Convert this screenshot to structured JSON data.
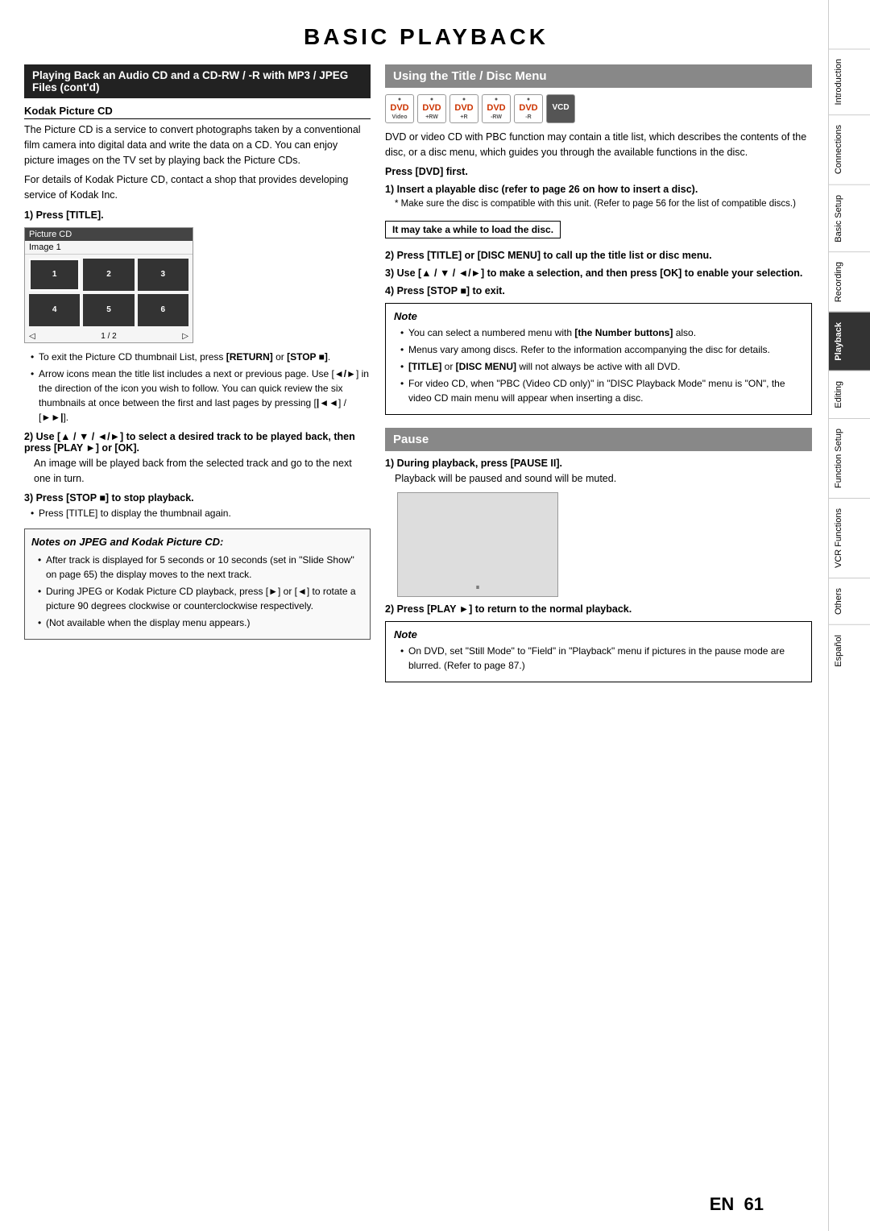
{
  "page": {
    "title": "BASIC PLAYBACK",
    "page_number": "EN 61"
  },
  "left_section": {
    "header": "Playing Back an Audio CD and a CD-RW / -R with MP3 / JPEG Files (cont'd)",
    "kodak": {
      "title": "Kodak Picture CD",
      "para1": "The Picture CD is a service to convert photographs taken by a conventional film camera into digital data and write the data on a CD. You can enjoy picture images on the TV set by playing back the Picture CDs.",
      "para2": "For details of Kodak Picture CD, contact a shop that provides developing service of Kodak Inc.",
      "step1_label": "1) Press [TITLE].",
      "picture_cd_label": "Picture CD",
      "image_label": "Image 1",
      "page_indicator": "1 / 2",
      "bullets1": [
        "To exit the Picture CD thumbnail List, press [RETURN] or [STOP ■].",
        "Arrow icons mean the title list includes a next or previous page. Use [◄/►] in the direction of the icon you wish to follow. You can quick review the six thumbnails at once between the first and last pages by pressing [|◄◄] / [►►|]."
      ],
      "step2_label": "2) Use [▲ / ▼ / ◄/►] to select a desired track to be played back, then press [PLAY ►] or [OK].",
      "step2_body": "An image will be played back from the selected track and go to the next one in turn.",
      "step3_label": "3) Press [STOP ■] to stop playback.",
      "step3_bullet": "Press [TITLE] to display the thumbnail again."
    },
    "notes_section": {
      "title": "Notes on JPEG and Kodak Picture CD:",
      "bullets": [
        "After track is displayed for 5 seconds or 10 seconds (set in \"Slide Show\" on page 65) the display moves to the next track.",
        "During JPEG or Kodak Picture CD playback, press [►] or [◄] to rotate a picture 90 degrees clockwise or counterclockwise respectively.",
        "(Not available when the display menu appears.)"
      ]
    }
  },
  "right_section": {
    "header": "Using the Title / Disc Menu",
    "disc_icons": [
      "DVD Video",
      "DVD +RW",
      "DVD +R",
      "DVD -RW",
      "DVD -R",
      "VCD"
    ],
    "intro": "DVD or video CD with PBC function may contain a title list, which describes the contents of the disc, or a disc menu, which guides you through the available functions in the disc.",
    "press_dvd_first": "Press [DVD] first.",
    "step1_label": "1) Insert a playable disc (refer to page 26 on how to insert a disc).",
    "step1_note": "* Make sure the disc is compatible with this unit. (Refer to page 56 for the list of compatible discs.)",
    "highlight": "It may take a while to load the disc.",
    "step2_label": "2) Press [TITLE] or [DISC MENU] to call up the title list or disc menu.",
    "step3_label": "3) Use [▲ / ▼ / ◄/►] to make a selection, and then press [OK] to enable your selection.",
    "step4_label": "4) Press [STOP ■] to exit.",
    "note": {
      "title": "Note",
      "bullets": [
        "You can select a numbered menu with [the Number buttons] also.",
        "Menus vary among discs. Refer to the information accompanying the disc for details.",
        "[TITLE] or [DISC MENU] will not always be active with all DVD.",
        "For video CD, when \"PBC (Video CD only)\" in \"DISC Playback Mode\" menu is \"ON\", the video CD main menu will appear when inserting a disc."
      ]
    },
    "pause_section": {
      "header": "Pause",
      "step1_label": "1) During playback, press [PAUSE II].",
      "step1_body": "Playback will be paused and sound will be muted.",
      "step2_label": "2) Press [PLAY ►] to return to the normal playback.",
      "note": {
        "title": "Note",
        "bullets": [
          "On DVD, set \"Still Mode\" to \"Field\" in \"Playback\" menu if pictures in the pause mode are blurred. (Refer to page 87.)"
        ]
      }
    }
  },
  "sidebar": {
    "items": [
      {
        "label": "Introduction"
      },
      {
        "label": "Connections"
      },
      {
        "label": "Basic Setup"
      },
      {
        "label": "Recording"
      },
      {
        "label": "Playback",
        "active": true
      },
      {
        "label": "Editing"
      },
      {
        "label": "Function Setup"
      },
      {
        "label": "VCR Functions"
      },
      {
        "label": "Others"
      },
      {
        "label": "Español"
      }
    ]
  }
}
